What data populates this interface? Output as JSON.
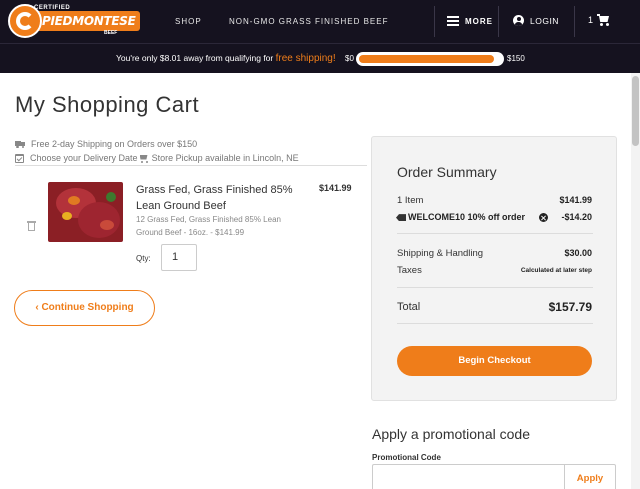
{
  "header": {
    "logo": {
      "top_text": "CERTIFIED",
      "main_text": "PIEDMONTESE",
      "bottom_text": "BEEF"
    },
    "nav": {
      "shop": "SHOP",
      "nongmo": "NON-GMO GRASS FINISHED BEEF"
    },
    "menu_label": "MORE",
    "login_label": "LOGIN",
    "cart_count": "1"
  },
  "shipping_bar": {
    "prefix": "You're only $8.01 away from qualifying for ",
    "highlight": "free shipping!",
    "min_label": "$0",
    "max_label": "$150",
    "progress_fraction": 0.95,
    "accent_color": "#ef7d1a"
  },
  "page": {
    "title": "My Shopping Cart"
  },
  "info": {
    "shipping": "Free 2-day Shipping on Orders over $150",
    "delivery": "Choose your Delivery Date",
    "pickup": "Store Pickup available in Lincoln, NE"
  },
  "cart_item": {
    "name": "Grass Fed, Grass Finished 85% Lean Ground Beef",
    "description": "12 Grass Fed, Grass Finished 85% Lean Ground Beef - 16oz. - $141.99",
    "price": "$141.99",
    "qty_label": "Qty:",
    "qty_value": "1"
  },
  "continue_label": "‹ Continue Shopping",
  "summary": {
    "title": "Order Summary",
    "items_label": "1 Item",
    "items_value": "$141.99",
    "coupon_label": "WELCOME10 10% off order",
    "coupon_value": "-$14.20",
    "shipping_label": "Shipping & Handling",
    "shipping_value": "$30.00",
    "taxes_label": "Taxes",
    "taxes_value": "Calculated at later step",
    "total_label": "Total",
    "total_value": "$157.79",
    "checkout_label": "Begin Checkout"
  },
  "promo": {
    "title": "Apply a promotional code",
    "field_label": "Promotional Code",
    "input_value": "",
    "apply_label": "Apply"
  }
}
